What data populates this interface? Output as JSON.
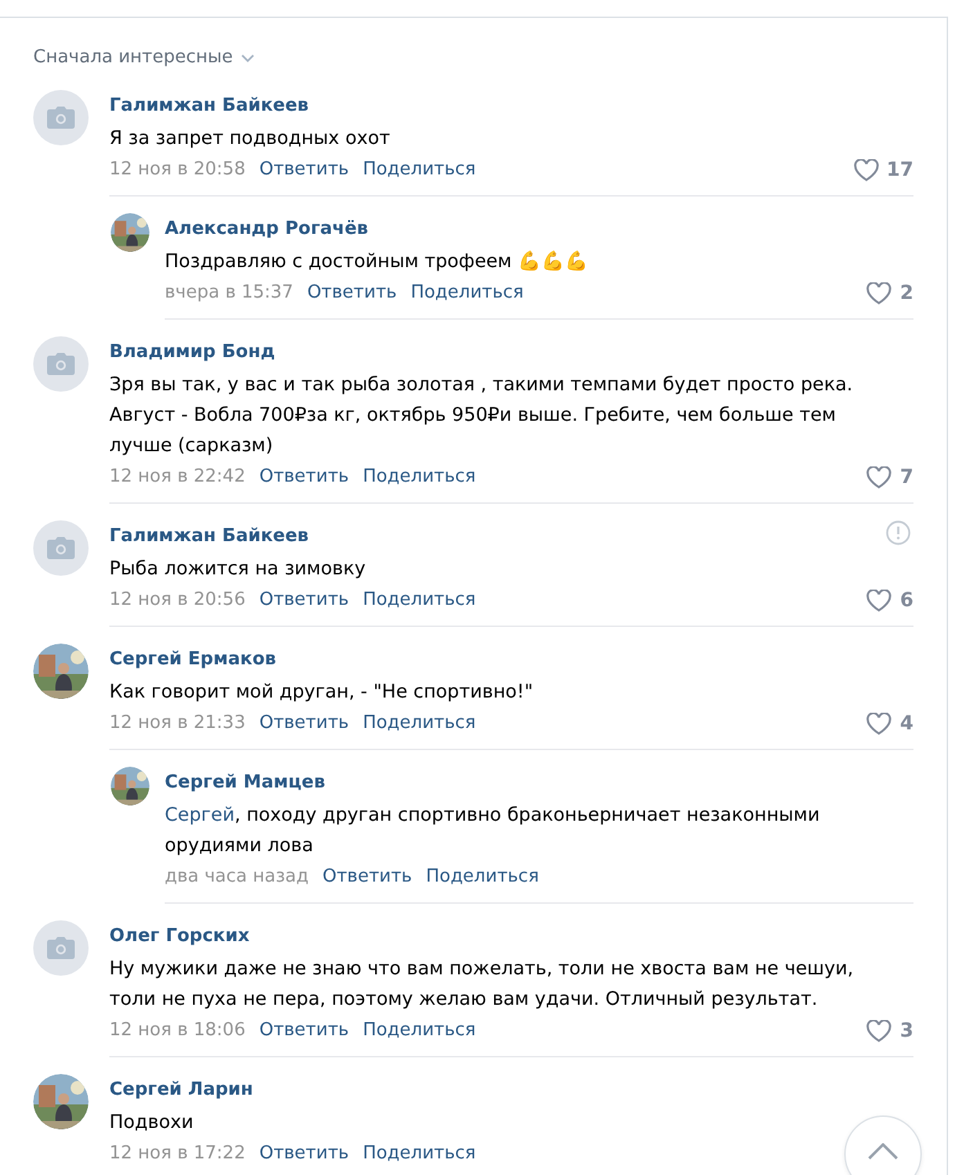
{
  "sort": {
    "label": "Сначала интересные"
  },
  "comments": [
    {
      "author": "Галимжан Байкеев",
      "avatar": {
        "kind": "placeholder"
      },
      "text": "Я за запрет подводных охот",
      "time": "12 ноя в 20:58",
      "reply": "Ответить",
      "share": "Поделиться",
      "likes": "17",
      "flagged": false,
      "children": [
        {
          "author": "Александр Рогачёв",
          "text": "Поздравляю с достойным трофеем 💪💪💪",
          "time": "вчера в 15:37",
          "reply": "Ответить",
          "share": "Поделиться",
          "likes": "2"
        }
      ]
    },
    {
      "author": "Владимир Бонд",
      "avatar": {
        "kind": "placeholder"
      },
      "text": "Зря вы так, у вас и так рыба золотая , такими темпами будет просто река. Август - Вобла 700₽за кг, октябрь 950₽и выше. Гребите, чем больше тем лучше (сарказм)",
      "time": "12 ноя в 22:42",
      "reply": "Ответить",
      "share": "Поделиться",
      "likes": "7",
      "flagged": false
    },
    {
      "author": "Галимжан Байкеев",
      "avatar": {
        "kind": "placeholder"
      },
      "text": "Рыба ложится на зимовку",
      "time": "12 ноя в 20:56",
      "reply": "Ответить",
      "share": "Поделиться",
      "likes": "6",
      "flagged": true
    },
    {
      "author": "Сергей Ермаков",
      "text": "Как говорит мой друган, - \"Не спортивно!\"",
      "time": "12 ноя в 21:33",
      "reply": "Ответить",
      "share": "Поделиться",
      "likes": "4",
      "flagged": false,
      "children": [
        {
          "author": "Сергей Мамцев",
          "mention": "Сергей",
          "text": ", походу друган спортивно браконьерничает незаконными орудиями лова",
          "time": "два часа назад",
          "reply": "Ответить",
          "share": "Поделиться"
        }
      ]
    },
    {
      "author": "Олег Горских",
      "avatar": {
        "kind": "placeholder"
      },
      "text": "Ну мужики даже не знаю что вам пожелать, толи не хвоста вам не чешуи, толи не пуха не пера, поэтому желаю вам удачи. Отличный результат.",
      "time": "12 ноя в 18:06",
      "reply": "Ответить",
      "share": "Поделиться",
      "likes": "3",
      "flagged": false
    },
    {
      "author": "Сергей Ларин",
      "text": "Подвохи",
      "time": "12 ноя в 17:22",
      "reply": "Ответить",
      "share": "Поделиться",
      "flagged": false
    }
  ]
}
